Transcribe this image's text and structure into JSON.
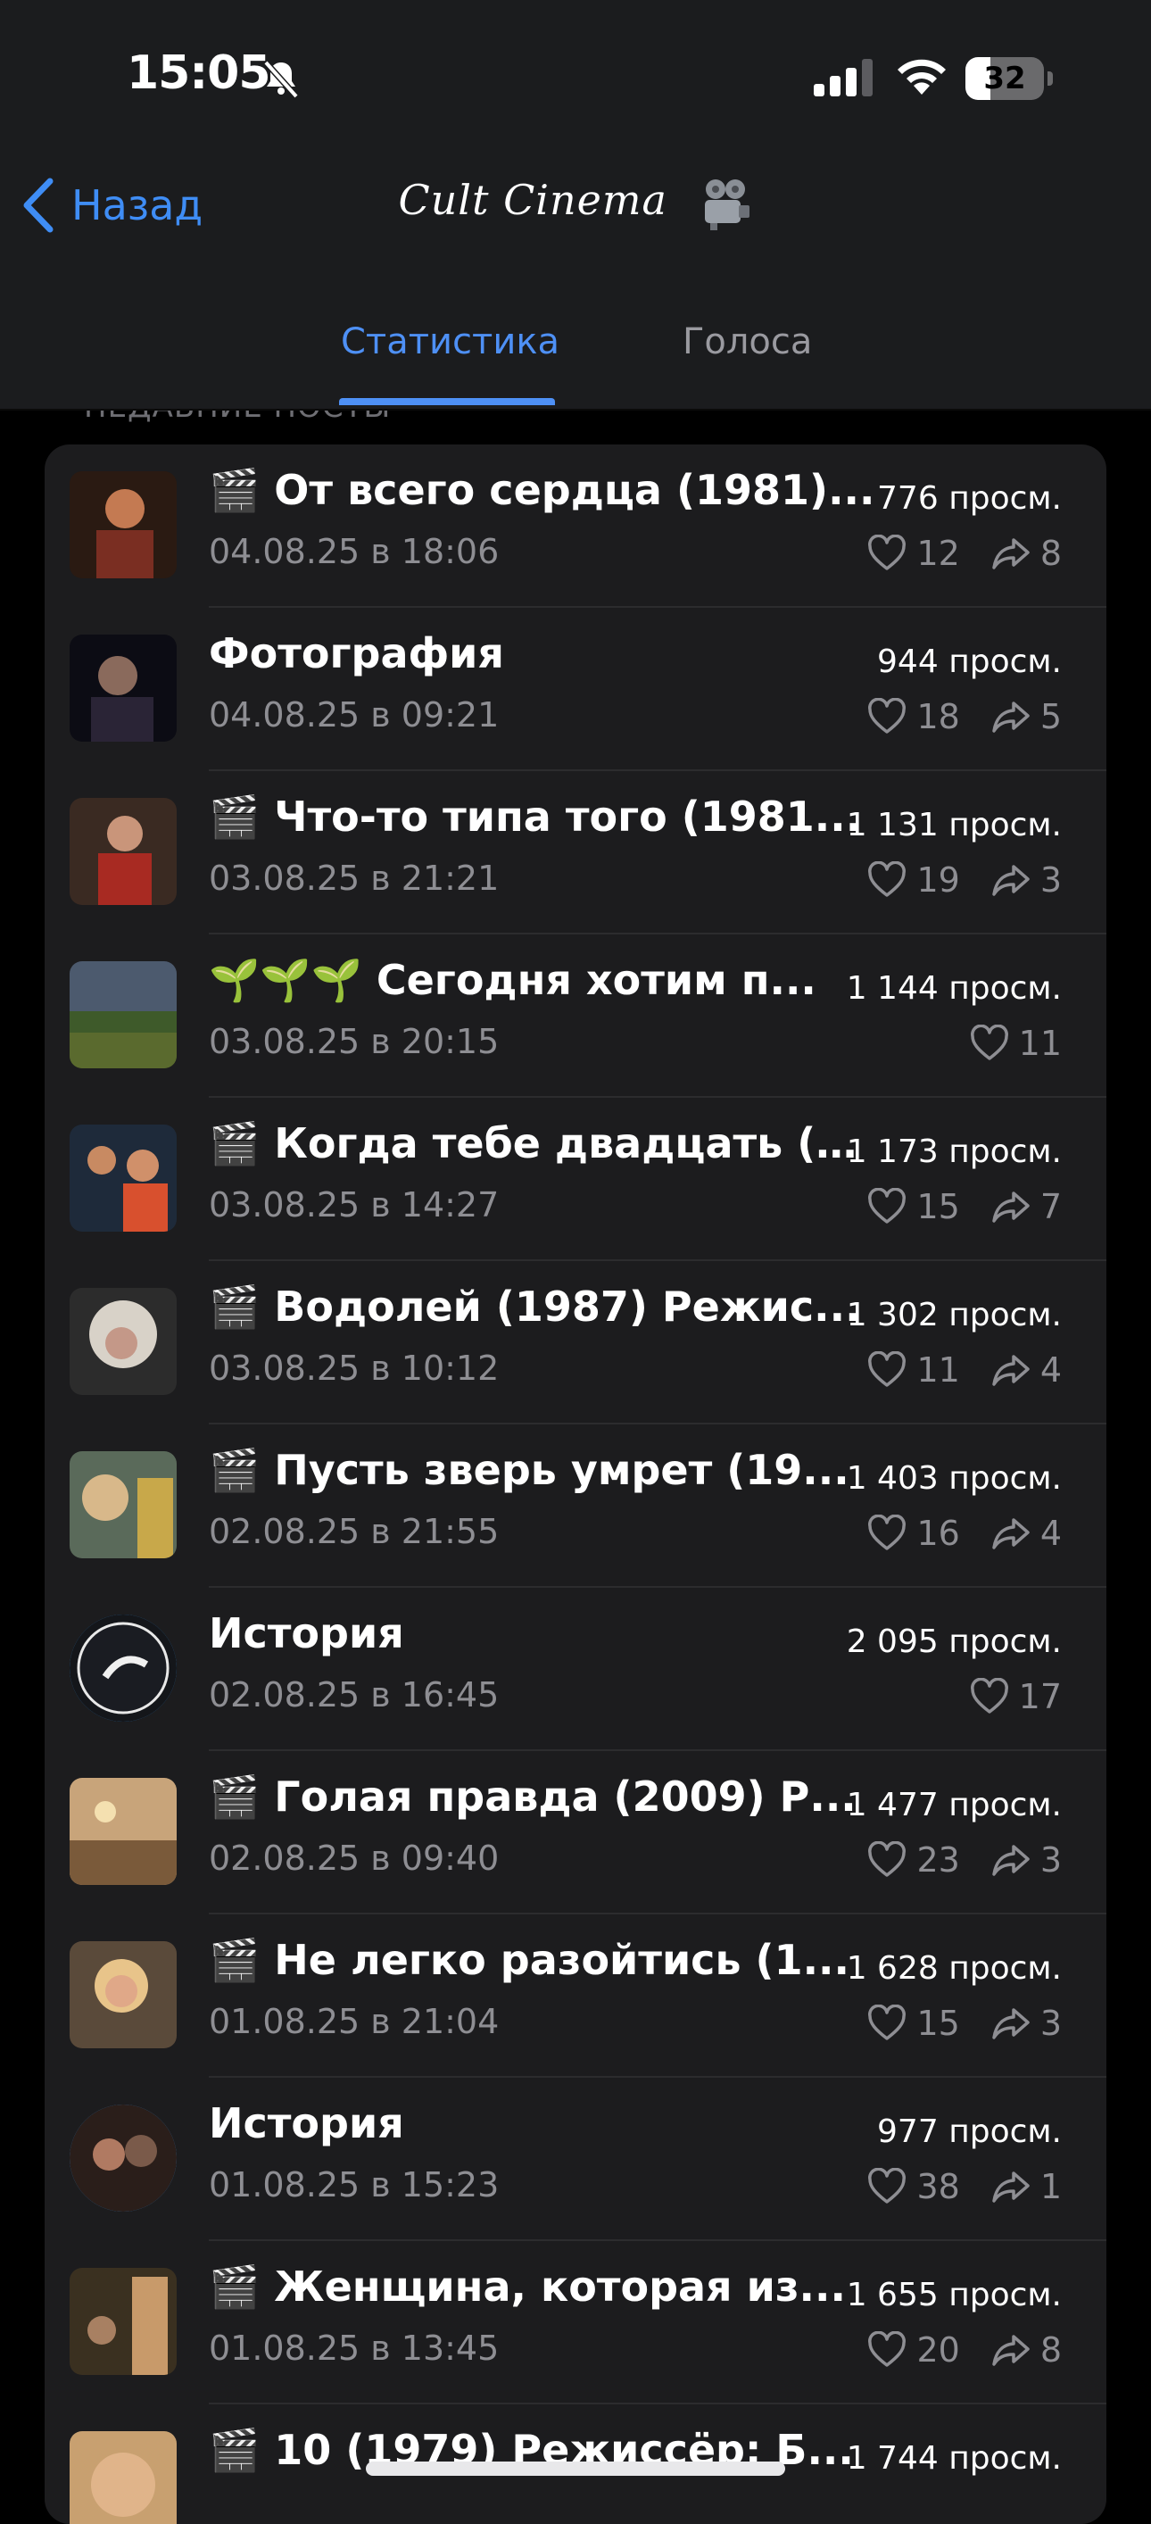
{
  "status_bar": {
    "time": "15:05",
    "battery": "32"
  },
  "nav": {
    "back_label": "Назад",
    "channel_title": "Cult Cinema"
  },
  "tabs": [
    {
      "label": "Статистика",
      "active": true
    },
    {
      "label": "Голоса",
      "active": false
    }
  ],
  "section_header": "НЕДАВНИЕ ПОСТЫ",
  "colors": {
    "accent": "#4e90f5",
    "background": "#000000",
    "card": "#1c1c1e",
    "secondary_text": "#8e8e93"
  },
  "posts": [
    {
      "title": "🎬 От всего сердца (1981)...",
      "date": "04.08.25 в 18:06",
      "views": "776 просм.",
      "likes": "12",
      "shares": "8",
      "thumb": "thumb-1"
    },
    {
      "title": "Фотография",
      "date": "04.08.25 в 09:21",
      "views": "944 просм.",
      "likes": "18",
      "shares": "5",
      "thumb": "thumb-2"
    },
    {
      "title": "🎬 Что-то типа того (1981...",
      "date": "03.08.25 в 21:21",
      "views": "1 131 просм.",
      "likes": "19",
      "shares": "3",
      "thumb": "thumb-3"
    },
    {
      "title": "🌱🌱🌱 Сегодня хотим п...",
      "date": "03.08.25 в 20:15",
      "views": "1 144 просм.",
      "likes": "11",
      "shares": null,
      "thumb": "thumb-4"
    },
    {
      "title": "🎬 Когда тебе двадцать (1...",
      "date": "03.08.25 в 14:27",
      "views": "1 173 просм.",
      "likes": "15",
      "shares": "7",
      "thumb": "thumb-5"
    },
    {
      "title": "🎬 Водолей (1987) Режис...",
      "date": "03.08.25 в 10:12",
      "views": "1 302 просм.",
      "likes": "11",
      "shares": "4",
      "thumb": "thumb-6"
    },
    {
      "title": "🎬 Пусть зверь умрет (19...",
      "date": "02.08.25 в 21:55",
      "views": "1 403 просм.",
      "likes": "16",
      "shares": "4",
      "thumb": "thumb-7"
    },
    {
      "title": "История",
      "date": "02.08.25 в 16:45",
      "views": "2 095 просм.",
      "likes": "17",
      "shares": null,
      "thumb": "story-1"
    },
    {
      "title": "🎬 Голая правда (2009) Р...",
      "date": "02.08.25 в 09:40",
      "views": "1 477 просм.",
      "likes": "23",
      "shares": "3",
      "thumb": "thumb-9"
    },
    {
      "title": "🎬 Не легко разойтись (1...",
      "date": "01.08.25 в 21:04",
      "views": "1 628 просм.",
      "likes": "15",
      "shares": "3",
      "thumb": "thumb-10"
    },
    {
      "title": "История",
      "date": "01.08.25 в 15:23",
      "views": "977 просм.",
      "likes": "38",
      "shares": "1",
      "thumb": "story-2"
    },
    {
      "title": "🎬 Женщина, которая из...",
      "date": "01.08.25 в 13:45",
      "views": "1 655 просм.",
      "likes": "20",
      "shares": "8",
      "thumb": "thumb-12"
    },
    {
      "title": "🎬 10 (1979) Режиссёр: Б...",
      "date": "",
      "views": "1 744 просм.",
      "likes": null,
      "shares": null,
      "thumb": "thumb-13"
    }
  ]
}
